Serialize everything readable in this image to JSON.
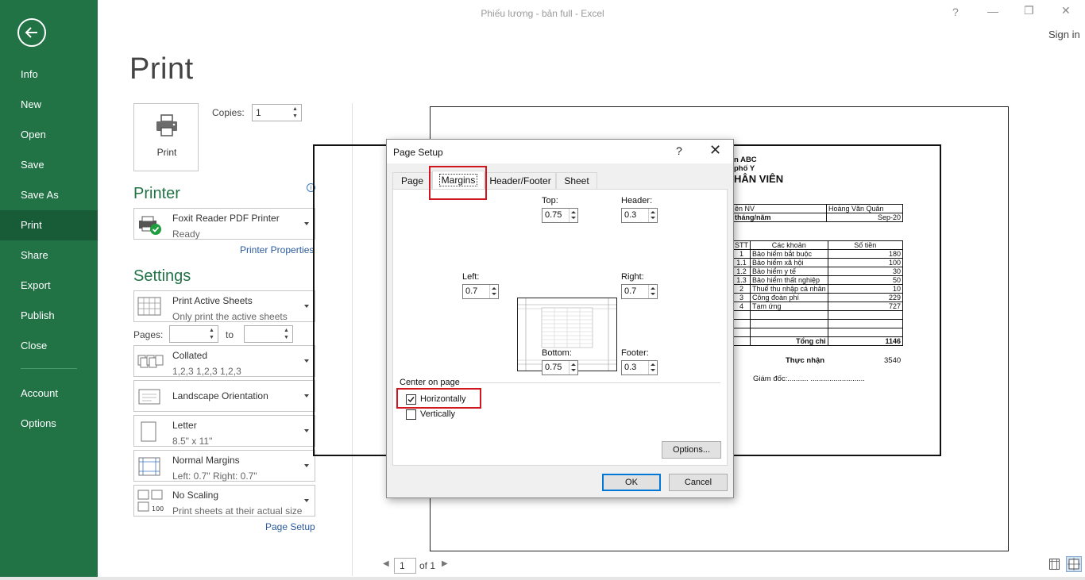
{
  "window": {
    "title": "Phiếu lương - bản full - Excel",
    "help_glyph": "?",
    "minimize_glyph": "—",
    "restore_glyph": "❐",
    "close_glyph": "✕",
    "sign_in": "Sign in"
  },
  "sidebar": {
    "items": [
      {
        "label": "Info"
      },
      {
        "label": "New"
      },
      {
        "label": "Open"
      },
      {
        "label": "Save"
      },
      {
        "label": "Save As"
      },
      {
        "label": "Print"
      },
      {
        "label": "Share"
      },
      {
        "label": "Export"
      },
      {
        "label": "Publish"
      },
      {
        "label": "Close"
      },
      {
        "label": "Account"
      },
      {
        "label": "Options"
      }
    ],
    "active": "Print"
  },
  "print": {
    "title": "Print",
    "button_label": "Print",
    "copies_label": "Copies:",
    "copies_value": "1"
  },
  "printer": {
    "heading": "Printer",
    "name": "Foxit Reader PDF Printer",
    "status": "Ready",
    "properties_link": "Printer Properties",
    "info_glyph": "i"
  },
  "settings": {
    "heading": "Settings",
    "scope": {
      "title": "Print Active Sheets",
      "subtitle": "Only print the active sheets"
    },
    "pages_label": "Pages:",
    "to_label": "to",
    "pages_from": "",
    "pages_to": "",
    "collation": {
      "title": "Collated",
      "subtitle": "1,2,3    1,2,3    1,2,3"
    },
    "orientation": {
      "title": "Landscape Orientation"
    },
    "paper": {
      "title": "Letter",
      "subtitle": "8.5\" x 11\""
    },
    "margins": {
      "title": "Normal Margins",
      "subtitle": "Left:  0.7\"    Right:  0.7\""
    },
    "scaling": {
      "title": "No Scaling",
      "subtitle": "Print sheets at their actual size",
      "icon_number": "100"
    },
    "page_setup_link": "Page Setup"
  },
  "preview": {
    "company": "n ABC",
    "city": "phố Y",
    "heading": "HÂN VIÊN",
    "info_rows": [
      {
        "label": "ên NV",
        "value": "Hoàng Văn Quân"
      },
      {
        "label": "tháng/năm",
        "value": "Sep-20"
      }
    ],
    "table_headers": {
      "stt": "STT",
      "item": "Các khoản",
      "amount": "Số tiền"
    },
    "rows": [
      {
        "stt": "1",
        "item": "Bảo hiểm bắt buộc",
        "amount": "180"
      },
      {
        "stt": "1.1",
        "item": "Bảo hiểm xã hội",
        "amount": "100"
      },
      {
        "stt": "1.2",
        "item": "Bảo hiểm y tế",
        "amount": "30"
      },
      {
        "stt": "1.3",
        "item": "Bảo hiểm thất nghiệp",
        "amount": "50"
      },
      {
        "stt": "2",
        "item": "Thuế thu nhập cá nhân",
        "amount": "10"
      },
      {
        "stt": "3",
        "item": "Công đoàn phí",
        "amount": "229"
      },
      {
        "stt": "4",
        "item": "Tạm ứng",
        "amount": "727"
      },
      {
        "stt": "",
        "item": "",
        "amount": ""
      },
      {
        "stt": "",
        "item": "",
        "amount": ""
      },
      {
        "stt": "",
        "item": "",
        "amount": ""
      }
    ],
    "total_label": "Tổng chi",
    "total_value": "1146",
    "net_label": "Thực nhận",
    "net_value": "3540",
    "director": "Giám đốc:.......... ..........................",
    "page_current": "1",
    "page_of": "of 1",
    "prev_glyph": "◀",
    "next_glyph": "▶"
  },
  "dialog": {
    "title": "Page Setup",
    "help_glyph": "?",
    "close_glyph": "✕",
    "tabs": [
      {
        "label": "Page"
      },
      {
        "label": "Margins"
      },
      {
        "label": "Header/Footer"
      },
      {
        "label": "Sheet"
      }
    ],
    "active_tab": "Margins",
    "top_label": "Top:",
    "top": "0.75",
    "header_label": "Header:",
    "header": "0.3",
    "left_label": "Left:",
    "left": "0.7",
    "right_label": "Right:",
    "right": "0.7",
    "bottom_label": "Bottom:",
    "bottom": "0.75",
    "footer_label": "Footer:",
    "footer": "0.3",
    "center_label": "Center on page",
    "horizontally_label": "Horizontally",
    "horizontally_checked": true,
    "vertically_label": "Vertically",
    "vertically_checked": false,
    "options_button": "Options...",
    "ok_button": "OK",
    "cancel_button": "Cancel"
  },
  "colors": {
    "sidebar": "#217346",
    "sidebar_active": "#185c37",
    "heading_green": "#217346",
    "link_blue": "#2a5a9e",
    "highlight_red": "#d0161f"
  }
}
